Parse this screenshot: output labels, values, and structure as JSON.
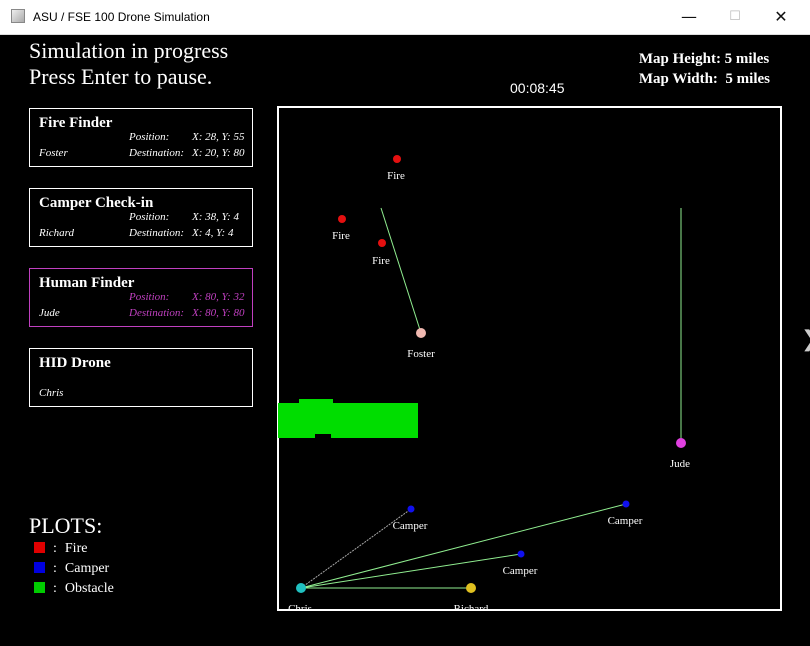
{
  "window": {
    "title": "ASU / FSE 100 Drone Simulation",
    "min_glyph": "—",
    "max_glyph": "☐",
    "close_glyph": "✕"
  },
  "status": {
    "line1": "Simulation in progress",
    "line2": "Press Enter to pause."
  },
  "timer": "00:08:45",
  "map_info": {
    "height": "Map Height: 5 miles",
    "width": "Map Width:  5 miles"
  },
  "drones": [
    {
      "name": "Fire Finder",
      "pilot": "Foster",
      "position_label": "Position:",
      "position": "X: 28, Y: 55",
      "destination_label": "Destination:",
      "destination": "X: 20, Y: 80"
    },
    {
      "name": "Camper Check-in",
      "pilot": "Richard",
      "position_label": "Position:",
      "position": "X: 38, Y: 4",
      "destination_label": "Destination:",
      "destination": "X: 4, Y: 4"
    },
    {
      "name": "Human Finder",
      "pilot": "Jude",
      "position_label": "Position:",
      "position": "X: 80, Y: 32",
      "destination_label": "Destination:",
      "destination": "X: 80, Y: 80"
    },
    {
      "name": "HID Drone",
      "pilot": "Chris",
      "position_label": "",
      "position": "",
      "destination_label": "",
      "destination": ""
    }
  ],
  "plots": {
    "title": "PLOTS:",
    "items": [
      {
        "label": "Fire",
        "separator": ":",
        "color": "#e00000"
      },
      {
        "label": "Camper",
        "separator": ":",
        "color": "#0000e0"
      },
      {
        "label": "Obstacle",
        "separator": ":",
        "color": "#00cc00"
      }
    ]
  },
  "colors": {
    "fire": "#e41010",
    "camper": "#1010ee",
    "obstacle": "#00dd00",
    "path": "#90ee90",
    "chris": "#20c0c0",
    "richard": "#e0c020",
    "foster": "#f0b8b0",
    "jude": "#e040e0",
    "map_border": "#ffffff"
  },
  "map_labels": {
    "fire_1": "Fire",
    "fire_2": "Fire",
    "fire_3": "Fire",
    "foster": "Foster",
    "jude": "Jude",
    "camper_1": "Camper",
    "camper_2": "Camper",
    "camper_3": "Camper",
    "chris": "Chris",
    "richard": "Richard"
  },
  "edge_glyph": "❯"
}
